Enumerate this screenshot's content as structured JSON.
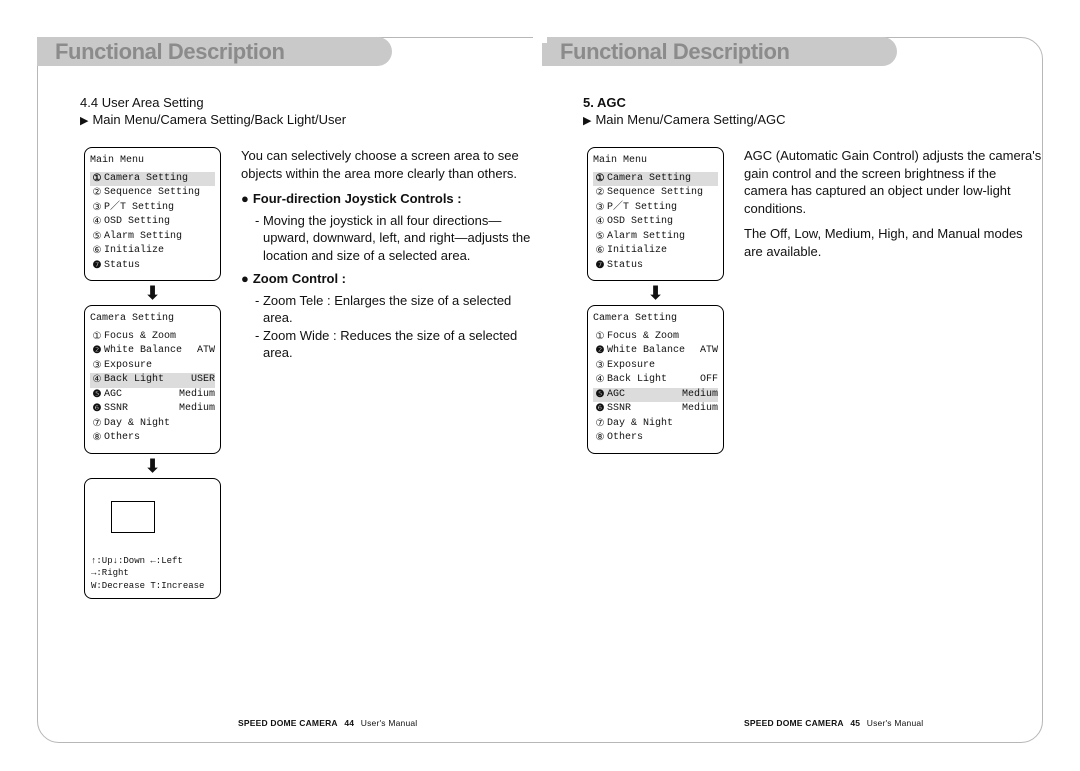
{
  "tab_title": "Functional Description",
  "left": {
    "section_no": "4.4",
    "section_title": "User Area Setting",
    "breadcrumb_marker": "▶",
    "breadcrumb": "Main Menu/Camera Setting/Back Light/User",
    "main_menu_title": "Main Menu",
    "main_menu": [
      {
        "n": "①",
        "label": "Camera Setting",
        "hl": true,
        "filled": true
      },
      {
        "n": "②",
        "label": "Sequence Setting",
        "hl": false,
        "filled": false
      },
      {
        "n": "③",
        "label": "P／T Setting",
        "hl": false,
        "filled": false
      },
      {
        "n": "④",
        "label": "OSD Setting",
        "hl": false,
        "filled": false
      },
      {
        "n": "⑤",
        "label": "Alarm Setting",
        "hl": false,
        "filled": false
      },
      {
        "n": "⑥",
        "label": "Initialize",
        "hl": false,
        "filled": false
      },
      {
        "n": "❼",
        "label": "Status",
        "hl": false,
        "filled": true
      }
    ],
    "camera_menu_title": "Camera Setting",
    "camera_menu": [
      {
        "n": "①",
        "label": "Focus & Zoom",
        "val": "",
        "hl": false,
        "filled": false
      },
      {
        "n": "❷",
        "label": "White Balance",
        "val": "ATW",
        "hl": false,
        "filled": true
      },
      {
        "n": "③",
        "label": "Exposure",
        "val": "",
        "hl": false,
        "filled": false
      },
      {
        "n": "④",
        "label": "Back Light",
        "val": "USER",
        "hl": true,
        "filled": false
      },
      {
        "n": "❺",
        "label": "AGC",
        "val": "Medium",
        "hl": false,
        "filled": true
      },
      {
        "n": "❻",
        "label": "SSNR",
        "val": "Medium",
        "hl": false,
        "filled": true
      },
      {
        "n": "⑦",
        "label": "Day & Night",
        "val": "",
        "hl": false,
        "filled": false
      },
      {
        "n": "⑧",
        "label": "Others",
        "val": "",
        "hl": false,
        "filled": false
      }
    ],
    "preview_line1": "↑:Up↓:Down ←:Left →:Right",
    "preview_line2": "W:Decrease  T:Increase",
    "lead": "You can selectively choose a screen area to see objects within the area more clearly than others.",
    "sub1_bullet": "●",
    "sub1": "Four-direction Joystick Controls :",
    "sub1_b1": "- Moving the joystick in all four directions—upward, downward, left, and right—adjusts the location and size of a selected area.",
    "sub2_bullet": "●",
    "sub2": "Zoom Control :",
    "sub2_b1": "- Zoom Tele : Enlarges the size of a selected area.",
    "sub2_b2": "- Zoom Wide : Reduces the size of a selected area.",
    "footer_prod": "SPEED DOME CAMERA",
    "footer_page": "44",
    "footer_tail": "User's Manual"
  },
  "right": {
    "section_no": "5.",
    "section_title": "AGC",
    "breadcrumb_marker": "▶",
    "breadcrumb": "Main Menu/Camera Setting/AGC",
    "main_menu_title": "Main Menu",
    "main_menu": [
      {
        "n": "①",
        "label": "Camera Setting",
        "hl": true,
        "filled": true
      },
      {
        "n": "②",
        "label": "Sequence Setting",
        "hl": false,
        "filled": false
      },
      {
        "n": "③",
        "label": "P／T Setting",
        "hl": false,
        "filled": false
      },
      {
        "n": "④",
        "label": "OSD Setting",
        "hl": false,
        "filled": false
      },
      {
        "n": "⑤",
        "label": "Alarm Setting",
        "hl": false,
        "filled": false
      },
      {
        "n": "⑥",
        "label": "Initialize",
        "hl": false,
        "filled": false
      },
      {
        "n": "❼",
        "label": "Status",
        "hl": false,
        "filled": true
      }
    ],
    "camera_menu_title": "Camera Setting",
    "camera_menu": [
      {
        "n": "①",
        "label": "Focus & Zoom",
        "val": "",
        "hl": false,
        "filled": false
      },
      {
        "n": "❷",
        "label": "White Balance",
        "val": "ATW",
        "hl": false,
        "filled": true
      },
      {
        "n": "③",
        "label": "Exposure",
        "val": "",
        "hl": false,
        "filled": false
      },
      {
        "n": "④",
        "label": "Back Light",
        "val": "OFF",
        "hl": false,
        "filled": false
      },
      {
        "n": "❺",
        "label": "AGC",
        "val": "Medium",
        "hl": true,
        "filled": true
      },
      {
        "n": "❻",
        "label": "SSNR",
        "val": "Medium",
        "hl": false,
        "filled": true
      },
      {
        "n": "⑦",
        "label": "Day & Night",
        "val": "",
        "hl": false,
        "filled": false
      },
      {
        "n": "⑧",
        "label": "Others",
        "val": "",
        "hl": false,
        "filled": false
      }
    ],
    "lead1": "AGC (Automatic Gain Control) adjusts the camera's gain control and the screen brightness if the camera has captured an object under low-light conditions.",
    "lead2": "The Off, Low, Medium, High, and Manual modes are available.",
    "footer_prod": "SPEED DOME CAMERA",
    "footer_page": "45",
    "footer_tail": "User's Manual"
  },
  "down_arrow": "⬇"
}
